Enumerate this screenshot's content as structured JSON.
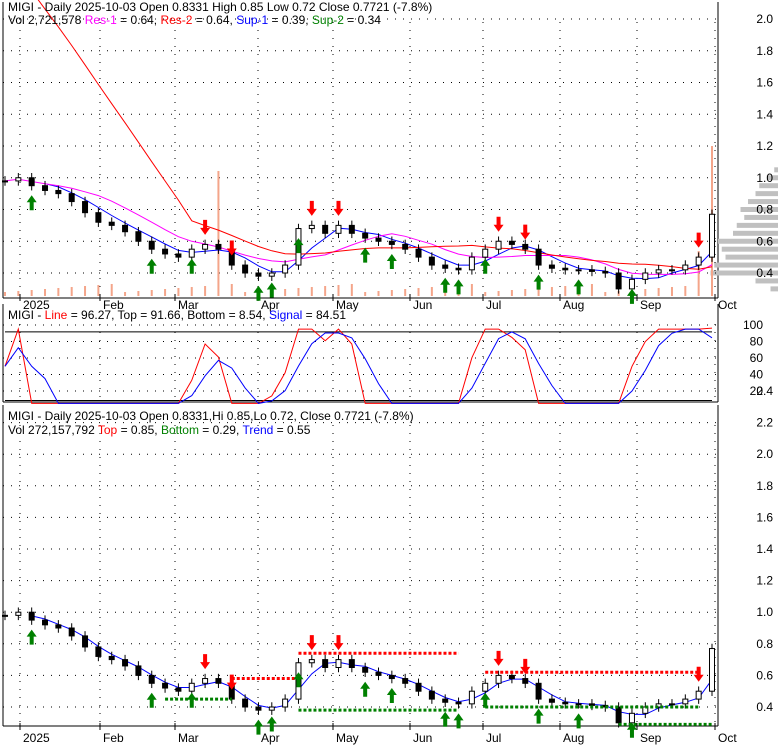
{
  "panel1": {
    "line1": "MIGI - Daily 2025-10-03 Open 0.8331  High 0.85  Low 0.72  Close 0.7721 (-7.8%)",
    "vol": "Vol 2,721,578",
    "res1": "Res-1",
    "res1_val": " = 0.64, ",
    "res2": "Res-2",
    "res2_val": " = 0.64, ",
    "sup1": "Sup-1",
    "sup1_val": " = 0.39, ",
    "sup2": "Sup-2",
    "sup2_val": " = 0.34"
  },
  "panel2": {
    "prefix": "MIGI - ",
    "line": "Line",
    "line_val": " = 96.27, Top = 91.66, Bottom = 8.54, ",
    "signal": "Signal",
    "signal_val": " = 84.51"
  },
  "panel3": {
    "line1": "MIGI - Daily 2025-10-03 Open 0.8331,Hi 0.85,Lo 0.72, Close 0.7721 (-7.8%)",
    "vol": "Vol 272,157,792 ",
    "top": "Top",
    "top_val": " = 0.85, ",
    "bottom": "Bottom",
    "bottom_val": " = 0.29, ",
    "trend": "Trend",
    "trend_val": " = 0.55"
  },
  "colors": {
    "up": "#ffffff",
    "down": "#000000",
    "res1": "#ff00ff",
    "res2": "#ff0000",
    "sup1": "#0000ff",
    "sup2": "#008000",
    "arrow_up": "#008000",
    "arrow_down": "#ff0000",
    "volume": "#f4a58a",
    "profile": "#c0c0c0"
  },
  "chart_data": [
    {
      "type": "candlestick",
      "title": "MIGI - Daily",
      "x_tick_labels": [
        "2025",
        "Feb",
        "Mar",
        "Apr",
        "May",
        "Jun",
        "Jul",
        "Aug",
        "Sep",
        "Oct"
      ],
      "y_tick_labels": [
        "0.4",
        "0.6",
        "0.8",
        "1.0",
        "1.2",
        "1.4",
        "1.6",
        "1.8",
        "2.0"
      ],
      "ylim": [
        0.25,
        2.1
      ],
      "closes": [
        0.98,
        1.0,
        0.95,
        0.92,
        0.9,
        0.85,
        0.78,
        0.72,
        0.7,
        0.66,
        0.6,
        0.55,
        0.52,
        0.5,
        0.55,
        0.58,
        0.55,
        0.45,
        0.4,
        0.38,
        0.4,
        0.45,
        0.68,
        0.7,
        0.65,
        0.7,
        0.65,
        0.62,
        0.6,
        0.58,
        0.55,
        0.5,
        0.45,
        0.43,
        0.42,
        0.5,
        0.55,
        0.6,
        0.58,
        0.55,
        0.45,
        0.43,
        0.42,
        0.42,
        0.41,
        0.4,
        0.3,
        0.36,
        0.4,
        0.42,
        0.42,
        0.45,
        0.5,
        0.77
      ],
      "up_arrows": [
        2,
        11,
        14,
        19,
        20,
        22,
        27,
        29,
        33,
        34,
        36,
        40,
        43,
        47
      ],
      "down_arrows": [
        15,
        17,
        23,
        25,
        37,
        39,
        52
      ],
      "volume_profile": {
        "prices": [
          0.3,
          0.35,
          0.4,
          0.45,
          0.5,
          0.55,
          0.6,
          0.65,
          0.7,
          0.75,
          0.8,
          0.85,
          0.9,
          0.95,
          1.0,
          1.05
        ],
        "volumes": [
          10,
          30,
          90,
          85,
          70,
          75,
          80,
          60,
          55,
          45,
          50,
          40,
          30,
          25,
          15,
          5
        ]
      }
    },
    {
      "type": "line",
      "title": "Stochastic",
      "y_tick_labels": [
        "20",
        "40",
        "60",
        "80",
        "100"
      ],
      "ylim": [
        0,
        100
      ],
      "series": [
        {
          "name": "Line",
          "value": 96.27
        },
        {
          "name": "Signal",
          "value": 84.51
        }
      ],
      "top": 91.66,
      "bottom": 8.54
    },
    {
      "type": "candlestick",
      "title": "MIGI - Daily trend",
      "x_tick_labels": [
        "2025",
        "Feb",
        "Mar",
        "Apr",
        "May",
        "Jun",
        "Jul",
        "Aug",
        "Sep",
        "Oct"
      ],
      "y_tick_labels": [
        "0.4",
        "0.6",
        "0.8",
        "1.0",
        "1.2",
        "1.4",
        "1.6",
        "1.8",
        "2.0",
        "2.2",
        "2.4"
      ],
      "ylim": [
        0.25,
        2.5
      ],
      "top": 0.85,
      "bottom": 0.29,
      "trend": 0.55
    }
  ]
}
